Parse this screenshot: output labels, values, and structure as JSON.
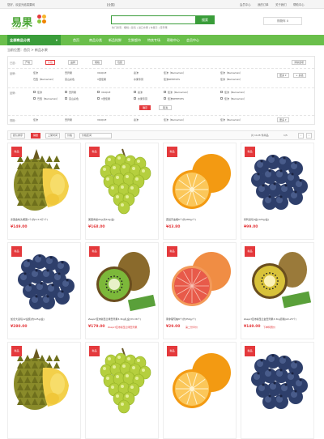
{
  "topbar": {
    "welcome": "您好，欢迎光临易果网",
    "location": "【全国】",
    "links": [
      "会员中心",
      "我的订单",
      "关于我们",
      "帮助中心"
    ]
  },
  "logo": {
    "text": "易果",
    "sub": "YIGUO.COM"
  },
  "search": {
    "placeholder": "",
    "button": "搜索",
    "hotwords": "热门搜索：樱桃 | 蓝莓 | 进口水果 | 车厘子 | 奇异果"
  },
  "cart": {
    "label": "购物车 0"
  },
  "nav": {
    "category": "全部商品分类",
    "items": [
      "首页",
      "商品分类",
      "新品抢鲜",
      "生鲜超市",
      "特卖专场",
      "帮助中心",
      "会员中心"
    ]
  },
  "breadcrumb": "当前位置：首页 > 新品水果",
  "filters": {
    "selected_label": "已选：",
    "selected": [
      "产地",
      "价格",
      "品牌",
      "规格",
      "包装"
    ],
    "clear": "清除选项",
    "brand_label": "品牌：",
    "more": "更多",
    "multi": "多选",
    "brands_row1": [
      "佳沛",
      "奇异果",
      "VKIQUE",
      "嘉沛",
      "巴西",
      "佳沛（Bamamini）",
      "佳沛（Bamamini）",
      "巴西（Bamamini）",
      "富山彩色",
      "V里佳果",
      "水果专营",
      "佳沛REHEVES",
      "佳沛（Bamamini）"
    ],
    "brand2_label": "品牌：",
    "confirm": "确定",
    "cancel": "取消",
    "spec_label": "规格：",
    "specs": [
      "佳沛",
      "奇异果",
      "VKIQUE",
      "嘉沛",
      "佳沛（Bamamini）",
      "佳沛（Bamamini）"
    ]
  },
  "sort": {
    "items": [
      "默认排序",
      "销量",
      "上架时间",
      "价格",
      "价格区间"
    ],
    "active": 1,
    "count": "共 1128 件商品",
    "page": "1/5"
  },
  "products": [
    {
      "tag": "新品",
      "name": "泰国金枕头榴莲1个(约3-3.5斤/个)",
      "price": "¥149.00",
      "promo": "",
      "img": "durian"
    },
    {
      "tag": "新品",
      "name": "美国青提2kg(约1kg/盒)",
      "price": "¥168.00",
      "promo": "",
      "img": "grapes"
    },
    {
      "tag": "新品",
      "name": "西班牙血橙6个(约180g/个)",
      "price": "¥43.80",
      "promo": "",
      "img": "orange"
    },
    {
      "tag": "新品",
      "name": "智利蓝莓4盒(125g/盒)",
      "price": "¥99.00",
      "promo": "",
      "img": "blueberry"
    },
    {
      "tag": "新品",
      "name": "加拿大蓝莓12盒装(约125g/盒)",
      "price": "¥280.00",
      "promo": "",
      "img": "blueberry"
    },
    {
      "tag": "新品",
      "name": "Zespri佳沛新西兰绿奇异果3.3kg礼盒(33-36个)",
      "price": "¥179.00",
      "promo": "Zespri佳沛新西兰绿奇异果",
      "img": "kiwi"
    },
    {
      "tag": "新品",
      "name": "南非葡萄柚8个(约350g/个)",
      "price": "¥29.00",
      "promo": "第二份半价",
      "img": "grapefruit"
    },
    {
      "tag": "新品",
      "name": "Zespri佳沛新西兰金奇异果3.3kg原箱(22-25个)",
      "price": "¥149.00",
      "promo": "下单特惠价",
      "img": "kiwi2"
    },
    {
      "tag": "新品",
      "name": "",
      "price": "",
      "promo": "",
      "img": "durian"
    },
    {
      "tag": "新品",
      "name": "",
      "price": "",
      "promo": "",
      "img": "grapes"
    },
    {
      "tag": "新品",
      "name": "",
      "price": "",
      "promo": "",
      "img": "orange"
    },
    {
      "tag": "新品",
      "name": "",
      "price": "",
      "promo": "",
      "img": "blueberry"
    }
  ],
  "colors": {
    "green": "#3a9d3a",
    "nav": "#6abf4b",
    "red": "#e4393c"
  }
}
